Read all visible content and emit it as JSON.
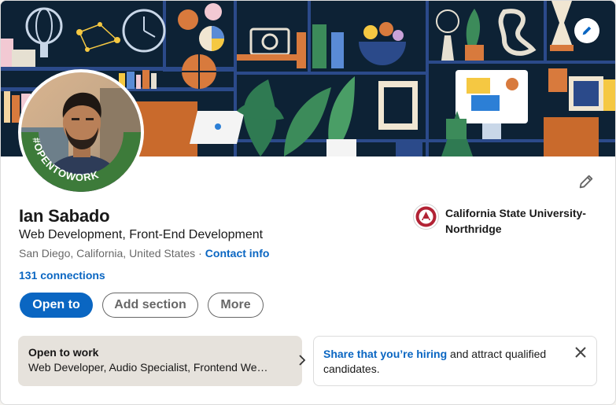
{
  "profile": {
    "name": "Ian Sabado",
    "headline": "Web Development, Front-End Development",
    "location": "San Diego, California, United States",
    "separator": "·",
    "contact_info": "Contact info",
    "connections": "131 connections",
    "badge_text": "#OPENTOWORK"
  },
  "education": {
    "school": "California State University-Northridge"
  },
  "actions": {
    "open_to": "Open to",
    "add_section": "Add section",
    "more": "More"
  },
  "open_to_work": {
    "title": "Open to work",
    "roles": "Web Developer, Audio Specialist, Frontend Web Developer and Web Designer roles"
  },
  "hiring": {
    "link_text": "Share that you’re hiring",
    "rest_text": " and attract qualified candidates."
  },
  "colors": {
    "brand_blue": "#0a66c2",
    "open_to_work_green": "#3d7b3a",
    "banner_bg": "#0d2235"
  },
  "icons": {
    "banner_edit": "pencil-icon",
    "intro_edit": "pencil-icon",
    "open_to_work_chevron": "chevron-right-icon",
    "hiring_close": "close-icon"
  }
}
